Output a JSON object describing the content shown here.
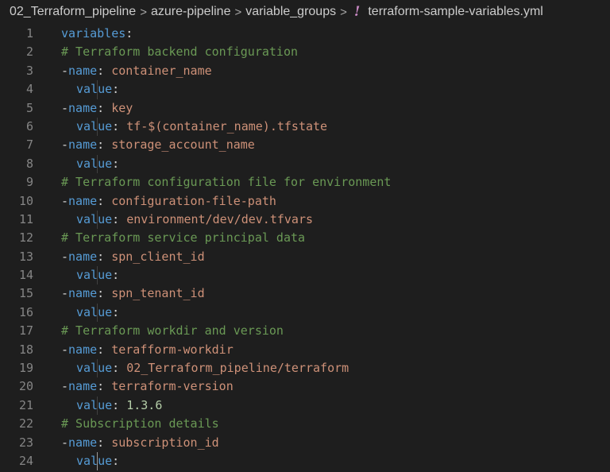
{
  "breadcrumb": {
    "items": [
      "02_Terraform_pipeline",
      "azure-pipeline",
      "variable_groups"
    ],
    "file_icon": "!",
    "file_name": "terraform-sample-variables.yml"
  },
  "colors": {
    "background": "#1e1e1e",
    "line_number": "#858585",
    "key": "#569cd6",
    "string": "#ce9178",
    "number": "#b5cea8",
    "comment": "#6a9955",
    "yaml_icon": "#c586c0"
  },
  "code": {
    "line_numbers": [
      "1",
      "2",
      "3",
      "4",
      "5",
      "6",
      "7",
      "8",
      "9",
      "10",
      "11",
      "12",
      "13",
      "14",
      "15",
      "16",
      "17",
      "18",
      "19",
      "20",
      "21",
      "22",
      "23",
      "24"
    ],
    "root_key": "variables",
    "comments": [
      "# Terraform backend configuration",
      "# Terraform configuration file for environment",
      "# Terraform service principal data",
      "# Terraform workdir and version",
      "# Subscription details"
    ],
    "dash": "-",
    "name_key": "name",
    "value_key": "value",
    "entries": [
      {
        "name": "container_name",
        "value": ""
      },
      {
        "name": "key",
        "value": "tf-$(container_name).tfstate"
      },
      {
        "name": "storage_account_name",
        "value": ""
      },
      {
        "name": "configuration-file-path",
        "value": "environment/dev/dev.tfvars"
      },
      {
        "name": "spn_client_id",
        "value": ""
      },
      {
        "name": "spn_tenant_id",
        "value": ""
      },
      {
        "name": "terafform-workdir",
        "value": "02_Terraform_pipeline/terraform"
      },
      {
        "name": "terraform-version",
        "value": "1.3.6"
      },
      {
        "name": "subscription_id",
        "value": ""
      }
    ]
  }
}
